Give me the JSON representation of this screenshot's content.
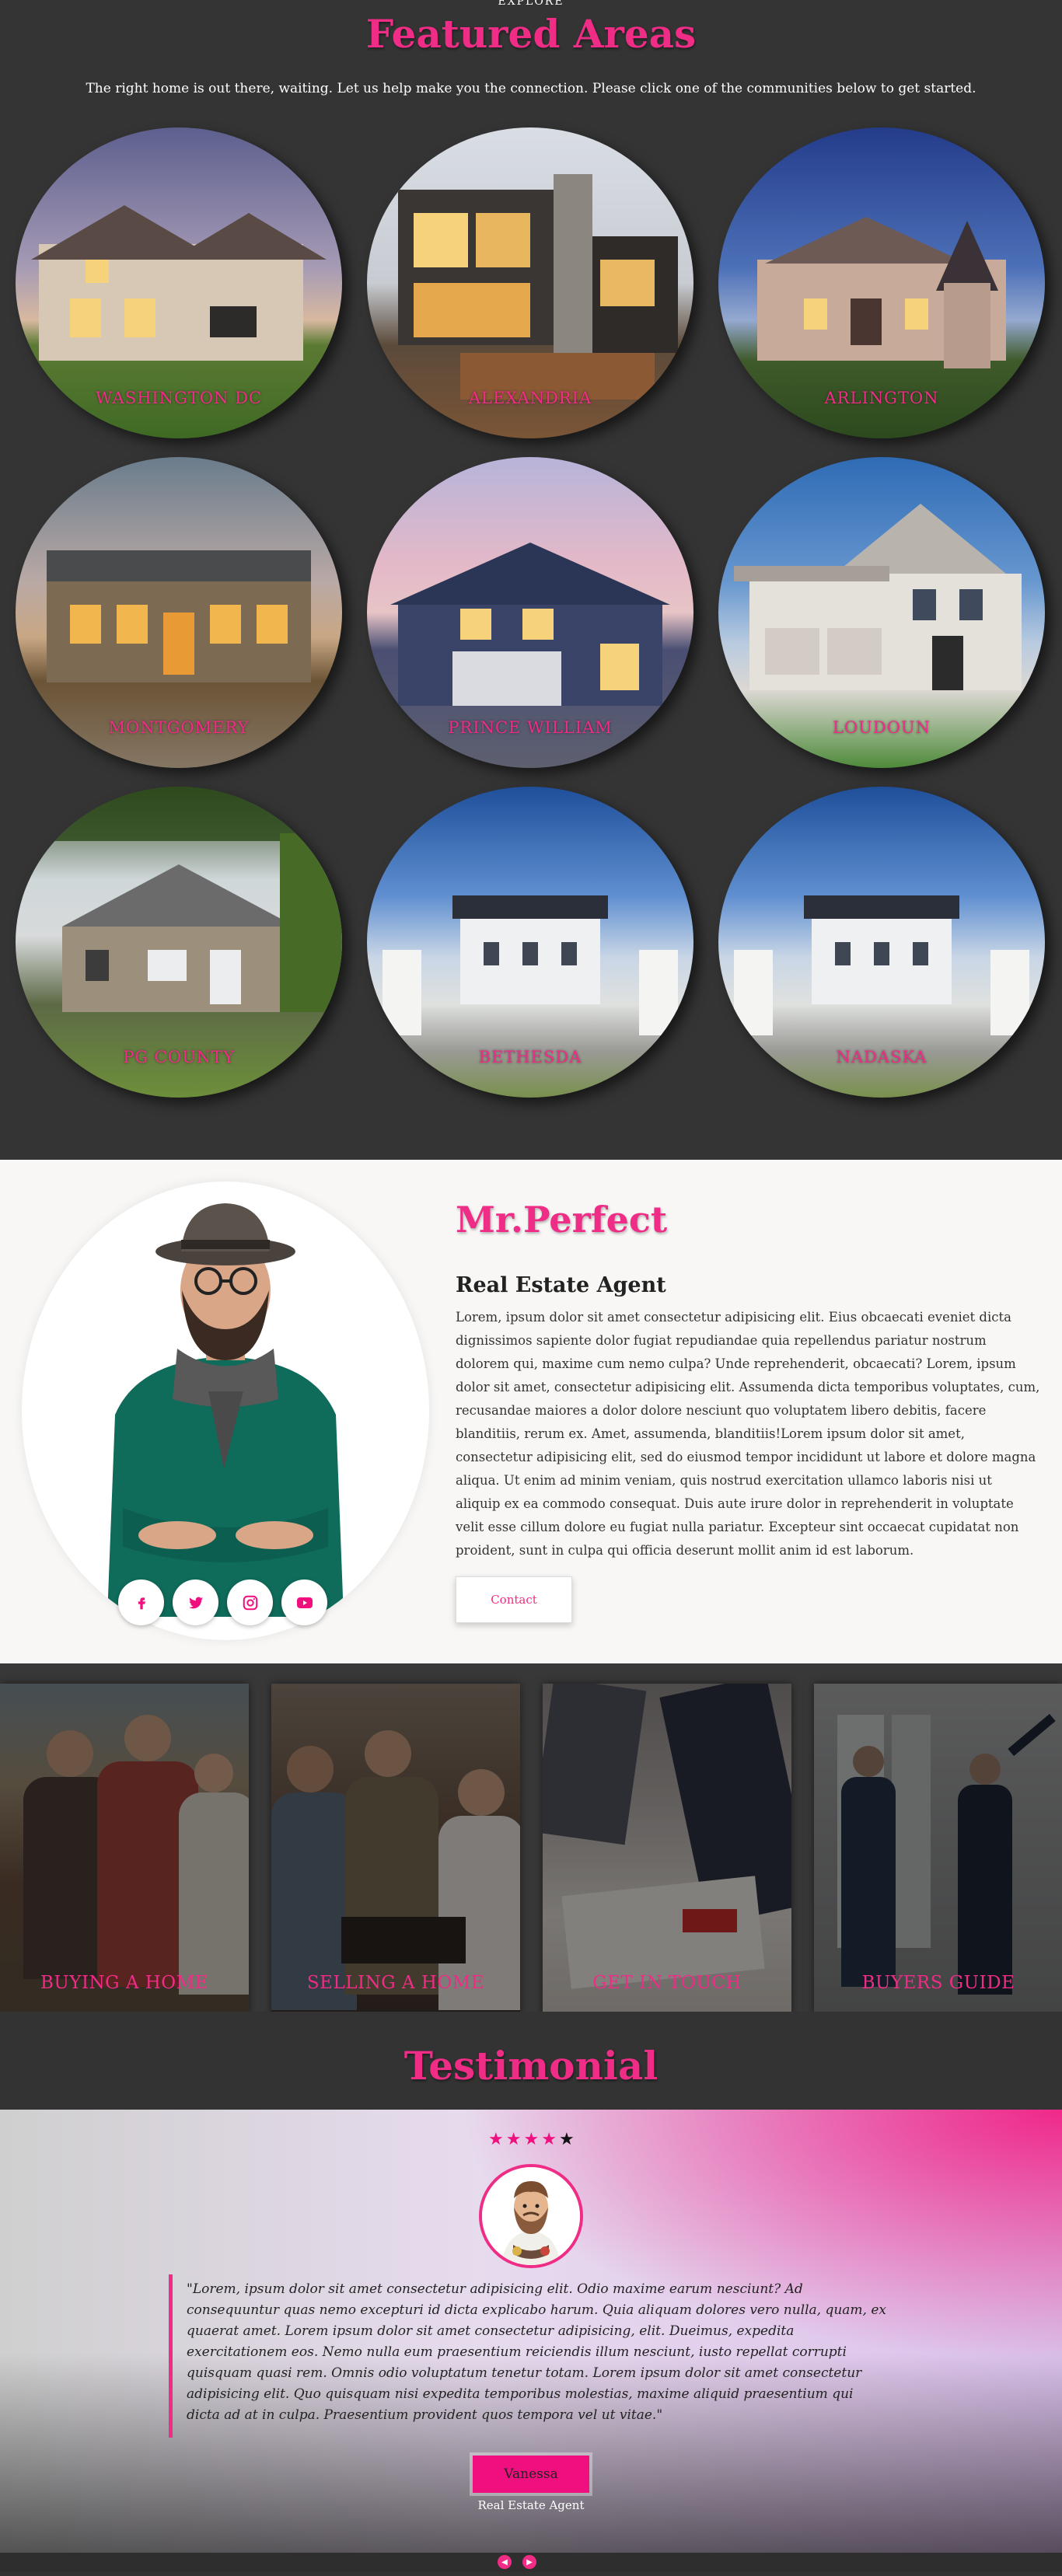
{
  "featured": {
    "explore": "EXPLORE",
    "title": "Featured Areas",
    "subtitle": "The right home is out there, waiting. Let us help make you the connection. Please click one of the communities below to get started.",
    "areas": [
      {
        "label": "WASHINGTON DC"
      },
      {
        "label": "ALEXANDRIA"
      },
      {
        "label": "ARLINGTON"
      },
      {
        "label": "MONTGOMERY"
      },
      {
        "label": "PRINCE WILLIAM"
      },
      {
        "label": "LOUDOUN"
      },
      {
        "label": "PG COUNTY"
      },
      {
        "label": "BETHESDA"
      },
      {
        "label": "NADASKA"
      }
    ]
  },
  "agent": {
    "name": "Mr.Perfect",
    "role": "Real Estate Agent",
    "bio": "Lorem, ipsum dolor sit amet consectetur adipisicing elit. Eius obcaecati eveniet dicta dignissimos sapiente dolor fugiat repudiandae quia repellendus pariatur nostrum dolorem qui, maxime cum nemo culpa? Unde reprehenderit, obcaecati? Lorem, ipsum dolor sit amet, consectetur adipisicing elit. Assumenda dicta temporibus voluptates, cum, recusandae maiores a dolor dolore nesciunt quo voluptatem libero debitis, facere blanditiis, rerum ex. Amet, assumenda, blanditiis!Lorem ipsum dolor sit amet, consectetur adipisicing elit, sed do eiusmod tempor incididunt ut labore et dolore magna aliqua. Ut enim ad minim veniam, quis nostrud exercitation ullamco laboris nisi ut aliquip ex ea commodo consequat. Duis aute irure dolor in reprehenderit in voluptate velit esse cillum dolore eu fugiat nulla pariatur. Excepteur sint occaecat cupidatat non proident, sunt in culpa qui officia deserunt mollit anim id est laborum.",
    "contact_label": "Contact",
    "socials": [
      "facebook-icon",
      "twitter-icon",
      "instagram-icon",
      "youtube-icon"
    ]
  },
  "services": [
    {
      "label": "BUYING A HOME"
    },
    {
      "label": "SELLING A HOME"
    },
    {
      "label": "GET IN TOUCH"
    },
    {
      "label": "BUYERS GUIDE"
    }
  ],
  "testimonial": {
    "title": "Testimonial",
    "rating": 4,
    "max_rating": 5,
    "quote": "\"Lorem, ipsum dolor sit amet consectetur adipisicing elit. Odio maxime earum nesciunt? Ad consequuntur quas nemo excepturi id dicta explicabo harum. Quia aliquam dolores vero nulla, quam, ex quaerat amet. Lorem ipsum dolor sit amet consectetur adipisicing, elit. Dueimus, expedita exercitationem eos. Nemo nulla eum praesentium reiciendis illum nesciunt, iusto repellat corrupti quisquam quasi rem. Omnis odio voluptatum tenetur totam. Lorem ipsum dolor sit amet consectetur adipisicing elit. Quo quisquam nisi expedita temporibus molestias, maxime aliquid praesentium qui dicta ad at in culpa. Praesentium provident quos tempora vel ut vitae.\"",
    "author": "Vanessa",
    "author_role": "Real Estate Agent"
  },
  "colors": {
    "accent": "#ef2c86",
    "dark_bg": "#343434",
    "light_bg": "#f8f7f5"
  }
}
